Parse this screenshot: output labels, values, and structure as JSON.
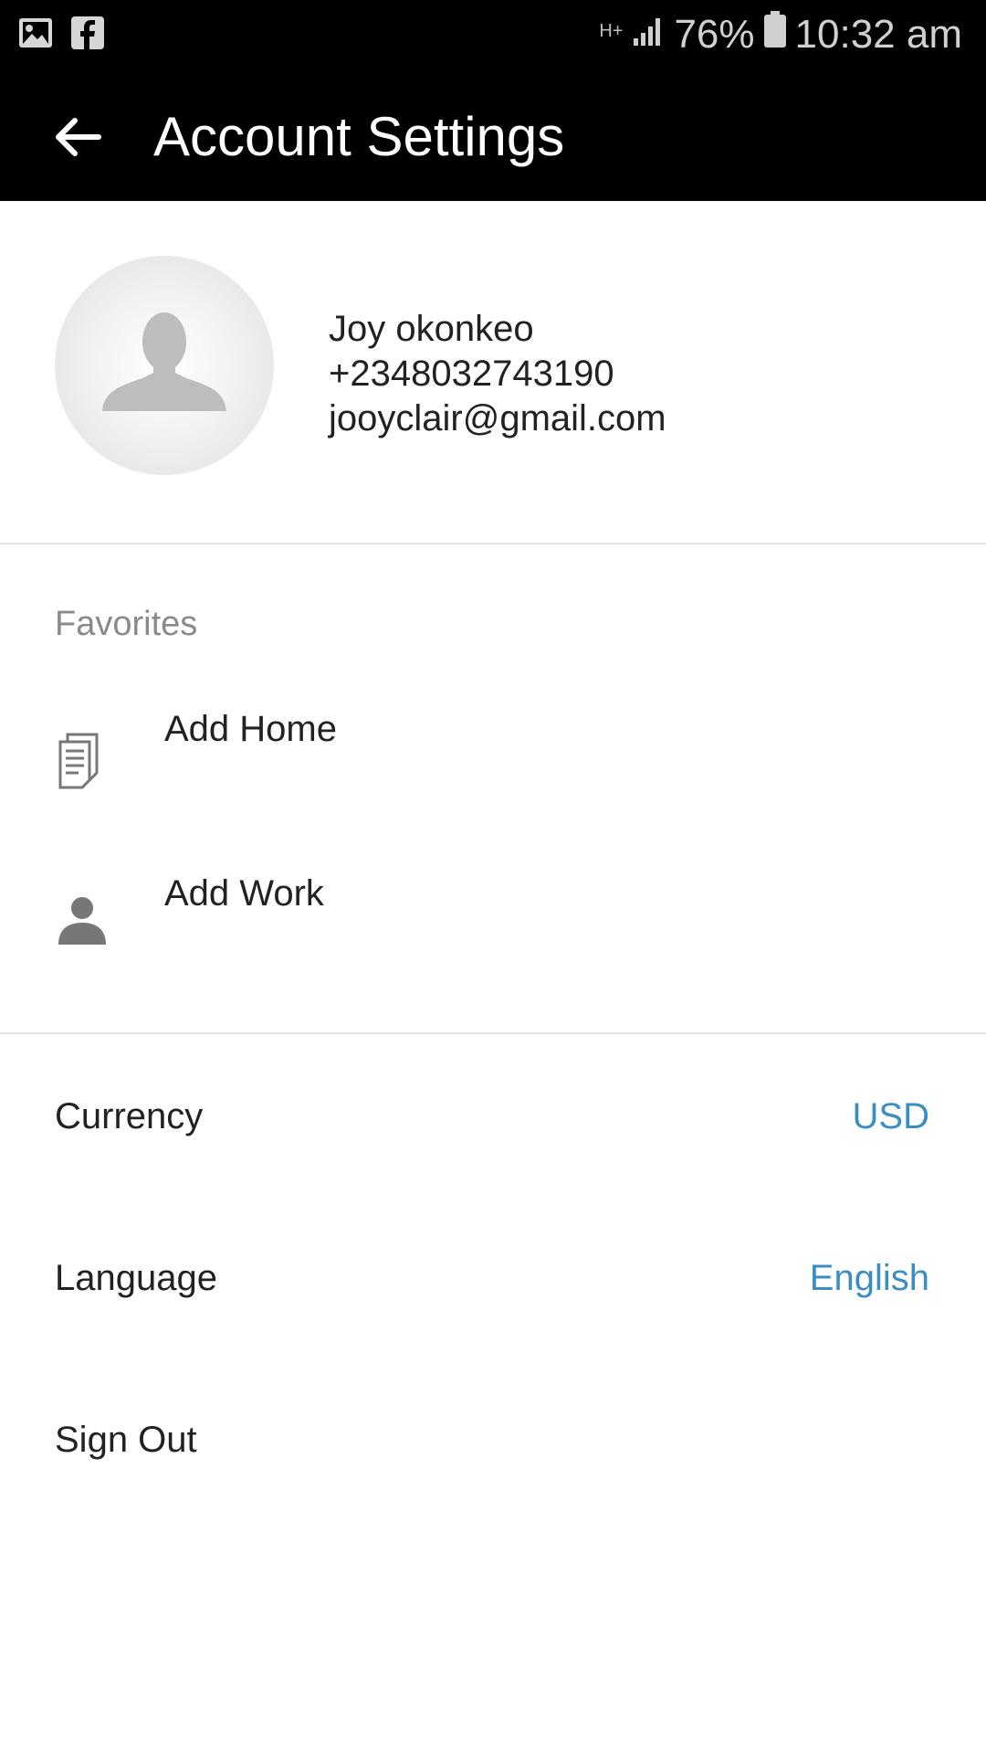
{
  "status_bar": {
    "network": "H+",
    "battery": "76%",
    "time": "10:32 am",
    "icons": [
      "gallery-icon",
      "facebook-icon",
      "network-type-icon",
      "signal-icon",
      "battery-icon"
    ]
  },
  "app_bar": {
    "title": "Account Settings",
    "back_icon": "back-arrow-icon"
  },
  "profile": {
    "name": "Joy okonkeo",
    "phone": "+2348032743190",
    "email": "jooyclair@gmail.com",
    "avatar_icon": "default-avatar-icon"
  },
  "favorites": {
    "section_label": "Favorites",
    "items": [
      {
        "label": "Add Home",
        "icon": "document-icon"
      },
      {
        "label": "Add Work",
        "icon": "person-icon"
      }
    ]
  },
  "settings": {
    "currency": {
      "label": "Currency",
      "value": "USD"
    },
    "language": {
      "label": "Language",
      "value": "English"
    },
    "sign_out": {
      "label": "Sign Out"
    }
  },
  "colors": {
    "bar_background": "#000000",
    "accent": "#3b8ec2",
    "muted_text": "#8a8a8a",
    "divider": "#e3e3e3"
  }
}
